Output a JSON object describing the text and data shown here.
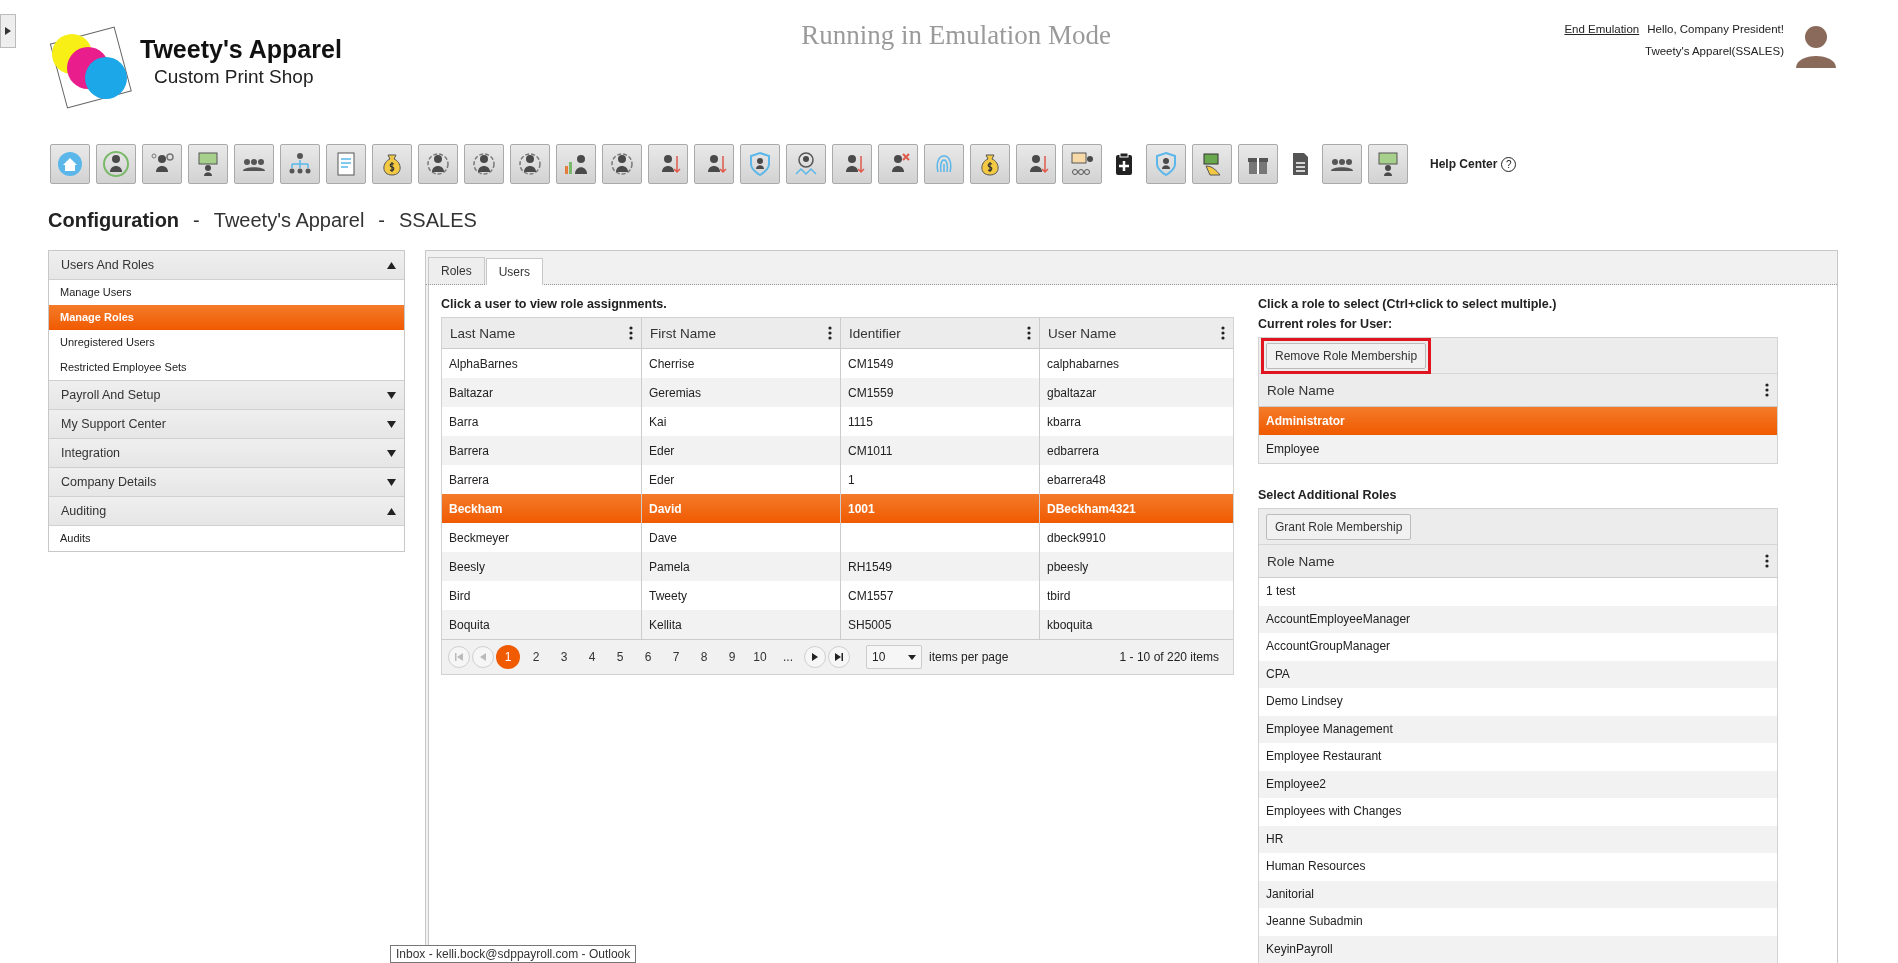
{
  "header": {
    "logo": {
      "title": "Tweety's Apparel",
      "subtitle": "Custom Print Shop"
    },
    "banner": "Running in Emulation Mode",
    "end_emulation": "End Emulation",
    "greeting": "Hello, Company President!",
    "account": "Tweety's Apparel(SSALES)"
  },
  "toolbar": {
    "help_label": "Help Center",
    "help_mark": "?"
  },
  "page_title": {
    "section": "Configuration",
    "separator_1": "-",
    "company": "Tweety's Apparel",
    "separator_2": "-",
    "code": "SSALES"
  },
  "sidebar": {
    "groups": [
      {
        "label": "Users And Roles",
        "expanded": true,
        "items": [
          {
            "label": "Manage Users",
            "selected": false
          },
          {
            "label": "Manage Roles",
            "selected": true
          },
          {
            "label": "Unregistered Users",
            "selected": false
          },
          {
            "label": "Restricted Employee Sets",
            "selected": false
          }
        ]
      },
      {
        "label": "Payroll And Setup",
        "expanded": false
      },
      {
        "label": "My Support Center",
        "expanded": false
      },
      {
        "label": "Integration",
        "expanded": false
      },
      {
        "label": "Company Details",
        "expanded": false
      },
      {
        "label": "Auditing",
        "expanded": true,
        "items": [
          {
            "label": "Audits",
            "selected": false
          }
        ]
      }
    ]
  },
  "tabs": [
    {
      "label": "Roles",
      "selected": false
    },
    {
      "label": "Users",
      "selected": true
    }
  ],
  "users": {
    "caption": "Click a user to view role assignments.",
    "columns": [
      "Last Name",
      "First Name",
      "Identifier",
      "User Name"
    ],
    "rows": [
      {
        "cells": [
          "AlphaBarnes",
          "Cherrise",
          "CM1549",
          "calphabarnes"
        ],
        "selected": false
      },
      {
        "cells": [
          "Baltazar",
          "Geremias",
          "CM1559",
          "gbaltazar"
        ],
        "selected": false
      },
      {
        "cells": [
          "Barra",
          "Kai",
          "1115",
          "kbarra"
        ],
        "selected": false
      },
      {
        "cells": [
          "Barrera",
          "Eder",
          "CM1011",
          "edbarrera"
        ],
        "selected": false
      },
      {
        "cells": [
          "Barrera",
          "Eder",
          "1",
          "ebarrera48"
        ],
        "selected": false
      },
      {
        "cells": [
          "Beckham",
          "David",
          "1001",
          "DBeckham4321"
        ],
        "selected": true
      },
      {
        "cells": [
          "Beckmeyer",
          "Dave",
          "",
          "dbeck9910"
        ],
        "selected": false
      },
      {
        "cells": [
          "Beesly",
          "Pamela",
          "RH1549",
          "pbeesly"
        ],
        "selected": false
      },
      {
        "cells": [
          "Bird",
          "Tweety",
          "CM1557",
          "tbird"
        ],
        "selected": false
      },
      {
        "cells": [
          "Boquita",
          "Kellita",
          "SH5005",
          "kboquita"
        ],
        "selected": false
      }
    ],
    "pager": {
      "pages": [
        {
          "label": "1",
          "selected": true
        },
        {
          "label": "2",
          "selected": false
        },
        {
          "label": "3",
          "selected": false
        },
        {
          "label": "4",
          "selected": false
        },
        {
          "label": "5",
          "selected": false
        },
        {
          "label": "6",
          "selected": false
        },
        {
          "label": "7",
          "selected": false
        },
        {
          "label": "8",
          "selected": false
        },
        {
          "label": "9",
          "selected": false
        },
        {
          "label": "10",
          "selected": false
        },
        {
          "label": "...",
          "selected": false
        }
      ],
      "page_size": "10",
      "page_size_label": "items per page",
      "summary": "1 - 10 of 220 items"
    }
  },
  "current_roles": {
    "caption_1": "Click a role to select (Ctrl+click to select multiple.)",
    "caption_2": "Current roles for User:",
    "button": {
      "label": "Remove Role Membership",
      "highlighted": true
    },
    "column": "Role Name",
    "rows": [
      {
        "name": "Administrator",
        "selected": true
      },
      {
        "name": "Employee",
        "selected": false
      }
    ]
  },
  "additional_roles": {
    "title": "Select Additional Roles",
    "button": {
      "label": "Grant Role Membership",
      "highlighted": false
    },
    "column": "Role Name",
    "rows": [
      {
        "name": "1 test",
        "selected": false
      },
      {
        "name": "AccountEmployeeManager",
        "selected": false
      },
      {
        "name": "AccountGroupManager",
        "selected": false
      },
      {
        "name": "CPA",
        "selected": false
      },
      {
        "name": "Demo Lindsey",
        "selected": false
      },
      {
        "name": "Employee Management",
        "selected": false
      },
      {
        "name": "Employee Restaurant",
        "selected": false
      },
      {
        "name": "Employee2",
        "selected": false
      },
      {
        "name": "Employees with Changes",
        "selected": false
      },
      {
        "name": "HR",
        "selected": false
      },
      {
        "name": "Human Resources",
        "selected": false
      },
      {
        "name": "Janitorial",
        "selected": false
      },
      {
        "name": "Jeanne Subadmin",
        "selected": false
      },
      {
        "name": "KeyinPayroll",
        "selected": false
      }
    ]
  },
  "tooltip": "Inbox - kelli.bock@sdppayroll.com - Outlook"
}
